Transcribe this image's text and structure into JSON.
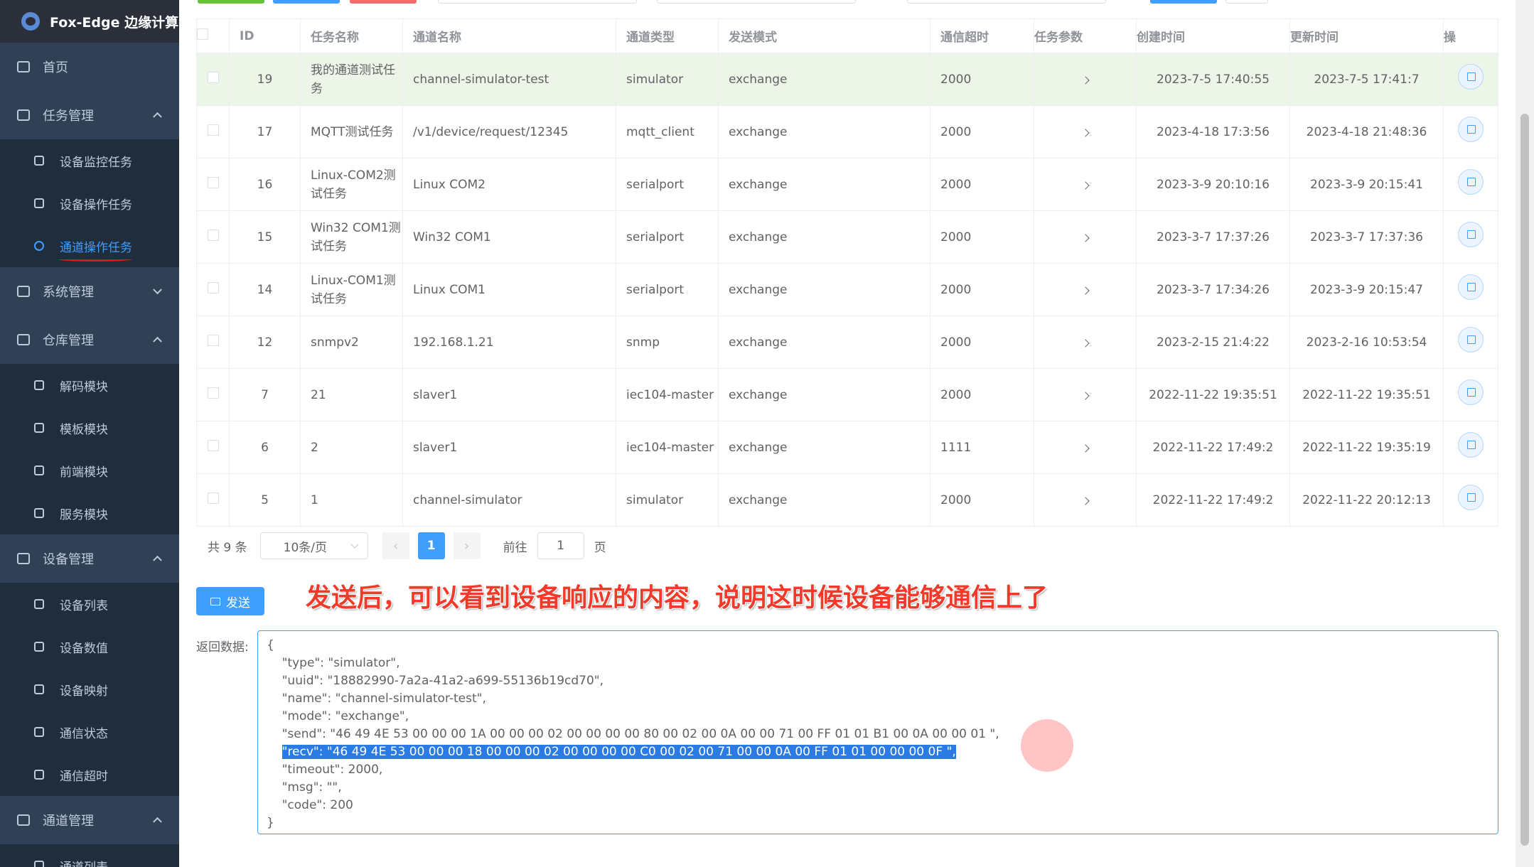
{
  "app": {
    "title": "Fox-Edge 边缘计算"
  },
  "sidebar": {
    "home": "首页",
    "task_mgmt": {
      "label": "任务管理",
      "items": [
        "设备监控任务",
        "设备操作任务",
        "通道操作任务"
      ]
    },
    "system_mgmt": "系统管理",
    "repo_mgmt": {
      "label": "仓库管理",
      "items": [
        "解码模块",
        "模板模块",
        "前端模块",
        "服务模块"
      ]
    },
    "device_mgmt": {
      "label": "设备管理",
      "items": [
        "设备列表",
        "设备数值",
        "设备映射",
        "通信状态",
        "通信超时"
      ]
    },
    "channel_mgmt": {
      "label": "通道管理",
      "items": [
        "通道列表"
      ]
    }
  },
  "table": {
    "headers": [
      "ID",
      "任务名称",
      "通道名称",
      "通道类型",
      "发送模式",
      "通信超时",
      "任务参数",
      "创建时间",
      "更新时间",
      "操"
    ],
    "rows": [
      {
        "id": "19",
        "task": "我的通道测试任务",
        "channel": "channel-simulator-test",
        "type": "simulator",
        "mode": "exchange",
        "timeout": "2000",
        "created": "2023-7-5 17:40:55",
        "updated": "2023-7-5 17:41:7"
      },
      {
        "id": "17",
        "task": "MQTT测试任务",
        "channel": "/v1/device/request/12345",
        "type": "mqtt_client",
        "mode": "exchange",
        "timeout": "2000",
        "created": "2023-4-18 17:3:56",
        "updated": "2023-4-18 21:48:36"
      },
      {
        "id": "16",
        "task": "Linux-COM2测试任务",
        "channel": "Linux COM2",
        "type": "serialport",
        "mode": "exchange",
        "timeout": "2000",
        "created": "2023-3-9 20:10:16",
        "updated": "2023-3-9 20:15:41"
      },
      {
        "id": "15",
        "task": "Win32 COM1测试任务",
        "channel": "Win32 COM1",
        "type": "serialport",
        "mode": "exchange",
        "timeout": "2000",
        "created": "2023-3-7 17:37:26",
        "updated": "2023-3-7 17:37:36"
      },
      {
        "id": "14",
        "task": "Linux-COM1测试任务",
        "channel": "Linux COM1",
        "type": "serialport",
        "mode": "exchange",
        "timeout": "2000",
        "created": "2023-3-7 17:34:26",
        "updated": "2023-3-9 20:15:47"
      },
      {
        "id": "12",
        "task": "snmpv2",
        "channel": "192.168.1.21",
        "type": "snmp",
        "mode": "exchange",
        "timeout": "2000",
        "created": "2023-2-15 21:4:22",
        "updated": "2023-2-16 10:53:54"
      },
      {
        "id": "7",
        "task": "21",
        "channel": "slaver1",
        "type": "iec104-master",
        "mode": "exchange",
        "timeout": "2000",
        "created": "2022-11-22 19:35:51",
        "updated": "2022-11-22 19:35:51"
      },
      {
        "id": "6",
        "task": "2",
        "channel": "slaver1",
        "type": "iec104-master",
        "mode": "exchange",
        "timeout": "1111",
        "created": "2022-11-22 17:49:2",
        "updated": "2022-11-22 19:35:19"
      },
      {
        "id": "5",
        "task": "1",
        "channel": "channel-simulator",
        "type": "simulator",
        "mode": "exchange",
        "timeout": "2000",
        "created": "2022-11-22 17:49:2",
        "updated": "2022-11-22 20:12:13"
      }
    ]
  },
  "pagination": {
    "total": "共 9 条",
    "page_size": "10条/页",
    "current_page": "1",
    "goto_label": "前往",
    "goto_value": "1",
    "page_suffix": "页"
  },
  "send": {
    "button_label": "发送",
    "annotation": "发送后，可以看到设备响应的内容，说明这时候设备能够通信上了"
  },
  "response": {
    "label": "返回数据:",
    "lines_before": [
      "{",
      "    \"type\": \"simulator\",",
      "    \"uuid\": \"18882990-7a2a-41a2-a699-55136b19cd70\",",
      "    \"name\": \"channel-simulator-test\",",
      "    \"mode\": \"exchange\",",
      "    \"send\": \"46 49 4E 53 00 00 00 1A 00 00 00 02 00 00 00 00 80 00 02 00 0A 00 00 71 00 FF 01 01 B1 00 0A 00 00 01 \","
    ],
    "indent": "    ",
    "selected": "\"recv\": \"46 49 4E 53 00 00 00 18 00 00 00 02 00 00 00 00 C0 00 02 00 71 00 00 0A 00 FF 01 01 00 00 00 0F \",",
    "lines_after": [
      "    \"timeout\": 2000,",
      "    \"msg\": \"\",",
      "    \"code\": 200",
      "}"
    ]
  }
}
